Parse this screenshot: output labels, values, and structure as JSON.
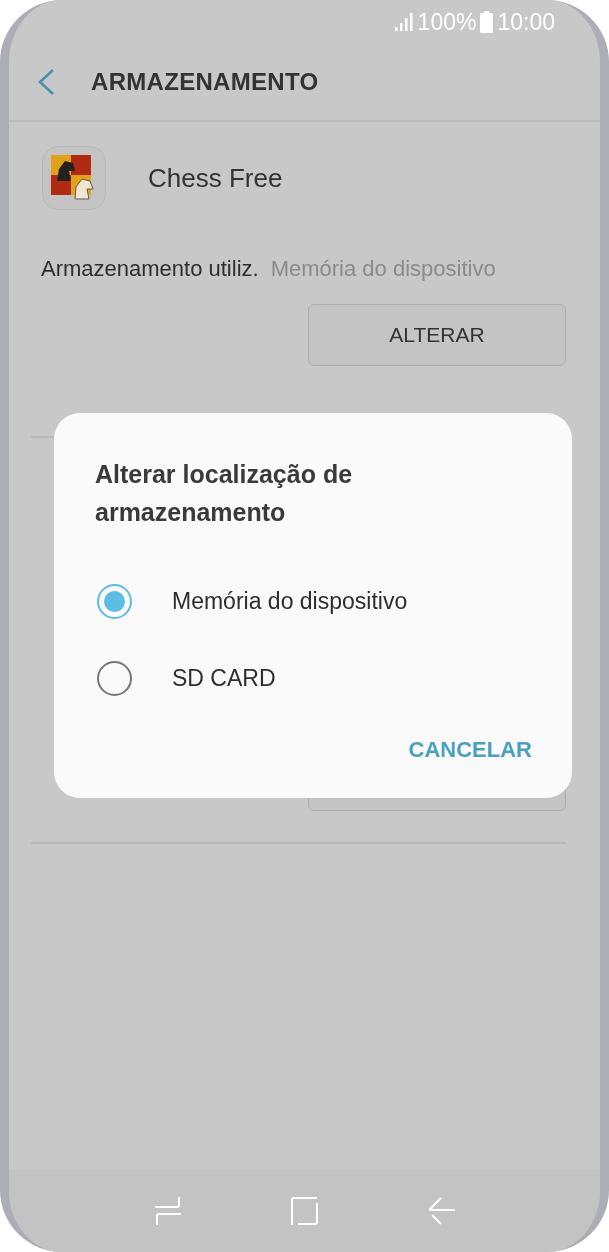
{
  "status_bar": {
    "battery": "100%",
    "time": "10:00"
  },
  "header": {
    "title": "ARMAZENAMENTO"
  },
  "app": {
    "name": "Chess Free"
  },
  "storage": {
    "label": "Armazenamento utiliz.",
    "value": "Memória do dispositivo",
    "button": "ALTERAR"
  },
  "dialog": {
    "title": "Alterar localização de armazenamento",
    "options": [
      {
        "label": "Memória do dispositivo",
        "selected": true
      },
      {
        "label": "SD CARD",
        "selected": false
      }
    ],
    "button": "CANCELAR"
  }
}
